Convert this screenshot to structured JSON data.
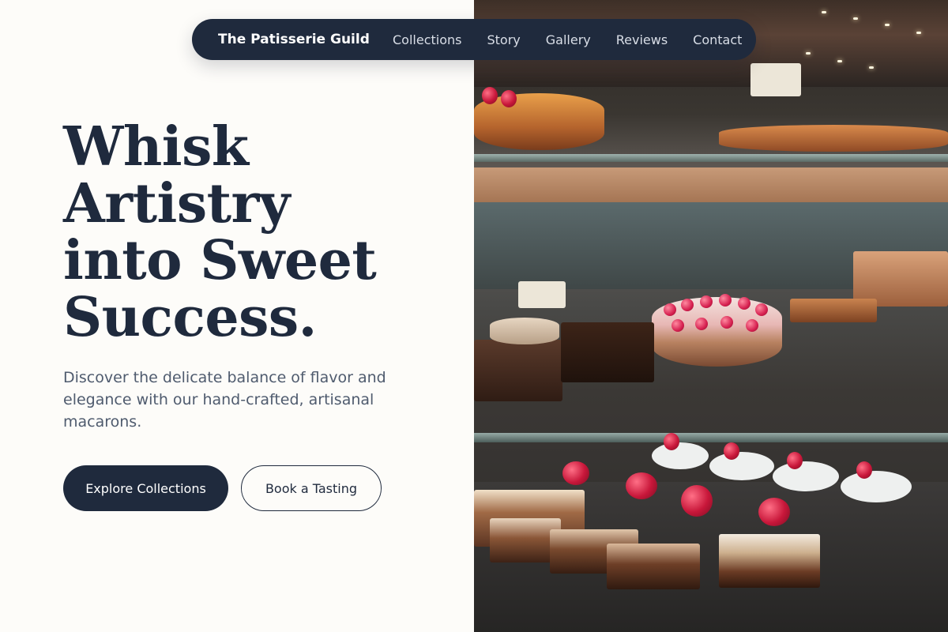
{
  "nav": {
    "brand": "The Patisserie Guild",
    "links": [
      "Collections",
      "Story",
      "Gallery",
      "Reviews",
      "Contact"
    ]
  },
  "hero": {
    "headline_lines": [
      "Whisk",
      "Artistry",
      "into Sweet",
      "Success."
    ],
    "subtext": "Discover the delicate balance of flavor and elegance with our hand-crafted, artisanal macarons.",
    "primary_button": "Explore Collections",
    "secondary_button": "Book a Tasting"
  },
  "image": {
    "description_icon": "pastry-display-photo"
  },
  "colors": {
    "navy": "#1f2a3d",
    "background": "#fdfcf9",
    "body_text": "#4f5b6e"
  }
}
